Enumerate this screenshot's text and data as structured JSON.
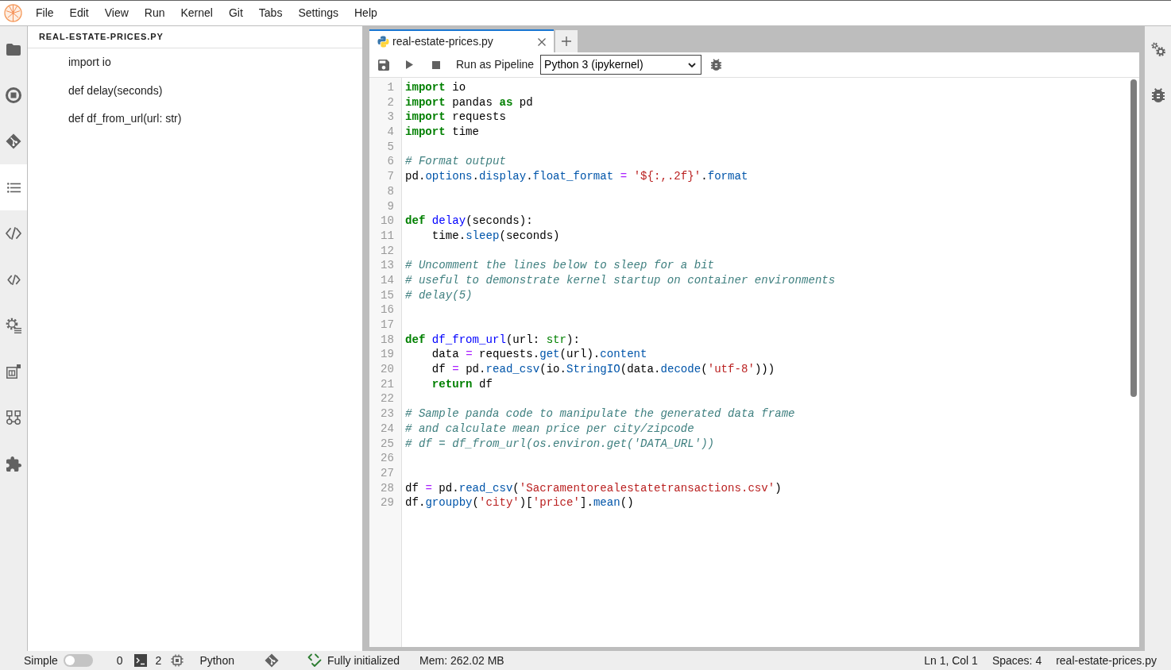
{
  "menu_bar": {
    "items": [
      "File",
      "Edit",
      "View",
      "Run",
      "Kernel",
      "Git",
      "Tabs",
      "Settings",
      "Help"
    ]
  },
  "left_sidebar_tabs": [
    {
      "selected": false
    },
    {
      "selected": false
    },
    {
      "selected": false
    },
    {
      "selected": true
    },
    {
      "selected": false
    },
    {
      "selected": false
    },
    {
      "selected": false
    },
    {
      "selected": false
    },
    {
      "selected": false
    },
    {
      "selected": false
    }
  ],
  "table_of_contents": {
    "title": "REAL-ESTATE-PRICES.PY",
    "items": [
      "import io",
      "def delay(seconds)",
      "def df_from_url(url: str)"
    ]
  },
  "editor_tabs": [
    {
      "label": "real-estate-prices.py",
      "selected": true
    }
  ],
  "toolbar": {
    "run_as_pipeline": "Run as Pipeline",
    "kernel": "Python 3 (ipykernel)"
  },
  "editor": {
    "lines": [
      {
        "number": "1",
        "tokens": [
          {
            "kind": "keyword",
            "text": "import"
          },
          {
            "kind": "plain",
            "text": " io"
          }
        ]
      },
      {
        "number": "2",
        "tokens": [
          {
            "kind": "keyword",
            "text": "import"
          },
          {
            "kind": "plain",
            "text": " pandas "
          },
          {
            "kind": "keyword",
            "text": "as"
          },
          {
            "kind": "plain",
            "text": " pd"
          }
        ]
      },
      {
        "number": "3",
        "tokens": [
          {
            "kind": "keyword",
            "text": "import"
          },
          {
            "kind": "plain",
            "text": " requests"
          }
        ]
      },
      {
        "number": "4",
        "tokens": [
          {
            "kind": "keyword",
            "text": "import"
          },
          {
            "kind": "plain",
            "text": " time"
          }
        ]
      },
      {
        "number": "5"
      },
      {
        "number": "6",
        "tokens": [
          {
            "kind": "comment",
            "text": "# Format output"
          }
        ]
      },
      {
        "number": "7",
        "tokens": [
          {
            "kind": "plain",
            "text": "pd."
          },
          {
            "kind": "property",
            "text": "options"
          },
          {
            "kind": "plain",
            "text": "."
          },
          {
            "kind": "property",
            "text": "display"
          },
          {
            "kind": "plain",
            "text": "."
          },
          {
            "kind": "property",
            "text": "float_format"
          },
          {
            "kind": "operator",
            "text": " = "
          },
          {
            "kind": "string",
            "text": "'${:,.2f}'"
          },
          {
            "kind": "plain",
            "text": "."
          },
          {
            "kind": "property",
            "text": "format"
          }
        ]
      },
      {
        "number": "8"
      },
      {
        "number": "9"
      },
      {
        "number": "10",
        "tokens": [
          {
            "kind": "keyword",
            "text": "def"
          },
          {
            "kind": "def",
            "text": " delay"
          },
          {
            "kind": "plain",
            "text": "(seconds):"
          }
        ]
      },
      {
        "number": "11",
        "tokens": [
          {
            "kind": "plain",
            "text": "    time."
          },
          {
            "kind": "property",
            "text": "sleep"
          },
          {
            "kind": "plain",
            "text": "(seconds)"
          }
        ]
      },
      {
        "number": "12"
      },
      {
        "number": "13",
        "tokens": [
          {
            "kind": "comment",
            "text": "# Uncomment the lines below to sleep for a bit"
          }
        ]
      },
      {
        "number": "14",
        "tokens": [
          {
            "kind": "comment",
            "text": "# useful to demonstrate kernel startup on container environments"
          }
        ]
      },
      {
        "number": "15",
        "tokens": [
          {
            "kind": "comment",
            "text": "# delay(5)"
          }
        ]
      },
      {
        "number": "16"
      },
      {
        "number": "17"
      },
      {
        "number": "18",
        "tokens": [
          {
            "kind": "keyword",
            "text": "def"
          },
          {
            "kind": "def",
            "text": " df_from_url"
          },
          {
            "kind": "plain",
            "text": "(url: "
          },
          {
            "kind": "builtin",
            "text": "str"
          },
          {
            "kind": "plain",
            "text": "):"
          }
        ]
      },
      {
        "number": "19",
        "tokens": [
          {
            "kind": "plain",
            "text": "    data "
          },
          {
            "kind": "operator",
            "text": "="
          },
          {
            "kind": "plain",
            "text": " requests."
          },
          {
            "kind": "property",
            "text": "get"
          },
          {
            "kind": "plain",
            "text": "(url)."
          },
          {
            "kind": "property",
            "text": "content"
          }
        ]
      },
      {
        "number": "20",
        "tokens": [
          {
            "kind": "plain",
            "text": "    df "
          },
          {
            "kind": "operator",
            "text": "="
          },
          {
            "kind": "plain",
            "text": " pd."
          },
          {
            "kind": "property",
            "text": "read_csv"
          },
          {
            "kind": "plain",
            "text": "(io."
          },
          {
            "kind": "property",
            "text": "StringIO"
          },
          {
            "kind": "plain",
            "text": "(data."
          },
          {
            "kind": "property",
            "text": "decode"
          },
          {
            "kind": "plain",
            "text": "("
          },
          {
            "kind": "string",
            "text": "'utf-8'"
          },
          {
            "kind": "plain",
            "text": ")))"
          }
        ]
      },
      {
        "number": "21",
        "tokens": [
          {
            "kind": "keyword",
            "text": "    return"
          },
          {
            "kind": "plain",
            "text": " df"
          }
        ]
      },
      {
        "number": "22"
      },
      {
        "number": "23",
        "tokens": [
          {
            "kind": "comment",
            "text": "# Sample panda code to manipulate the generated data frame"
          }
        ]
      },
      {
        "number": "24",
        "tokens": [
          {
            "kind": "comment",
            "text": "# and calculate mean price per city/zipcode"
          }
        ]
      },
      {
        "number": "25",
        "tokens": [
          {
            "kind": "comment",
            "text": "# df = df_from_url(os.environ.get('DATA_URL'))"
          }
        ]
      },
      {
        "number": "26"
      },
      {
        "number": "27"
      },
      {
        "number": "28",
        "tokens": [
          {
            "kind": "plain",
            "text": "df "
          },
          {
            "kind": "operator",
            "text": "="
          },
          {
            "kind": "plain",
            "text": " pd."
          },
          {
            "kind": "property",
            "text": "read_csv"
          },
          {
            "kind": "plain",
            "text": "("
          },
          {
            "kind": "string",
            "text": "'Sacramentorealestatetransactions.csv'"
          },
          {
            "kind": "plain",
            "text": ")"
          }
        ]
      },
      {
        "number": "29",
        "tokens": [
          {
            "kind": "plain",
            "text": "df."
          },
          {
            "kind": "property",
            "text": "groupby"
          },
          {
            "kind": "plain",
            "text": "("
          },
          {
            "kind": "string",
            "text": "'city'"
          },
          {
            "kind": "plain",
            "text": ")["
          },
          {
            "kind": "string",
            "text": "'price'"
          },
          {
            "kind": "plain",
            "text": "]."
          },
          {
            "kind": "property",
            "text": "mean"
          },
          {
            "kind": "plain",
            "text": "()"
          }
        ]
      }
    ]
  },
  "right_sidebar_tabs": [
    {
      "selected": false
    },
    {
      "selected": false
    }
  ],
  "status_bar": {
    "simple_mode": {
      "label": "Simple",
      "on": false
    },
    "terminals": "0",
    "kernels": "2",
    "kernel_name": "Python",
    "kernel_status": "Fully initialized",
    "memory": "Mem: 262.02 MB",
    "cursor": "Ln 1, Col 1",
    "indent": "Spaces: 4",
    "file_name": "real-estate-prices.py"
  }
}
